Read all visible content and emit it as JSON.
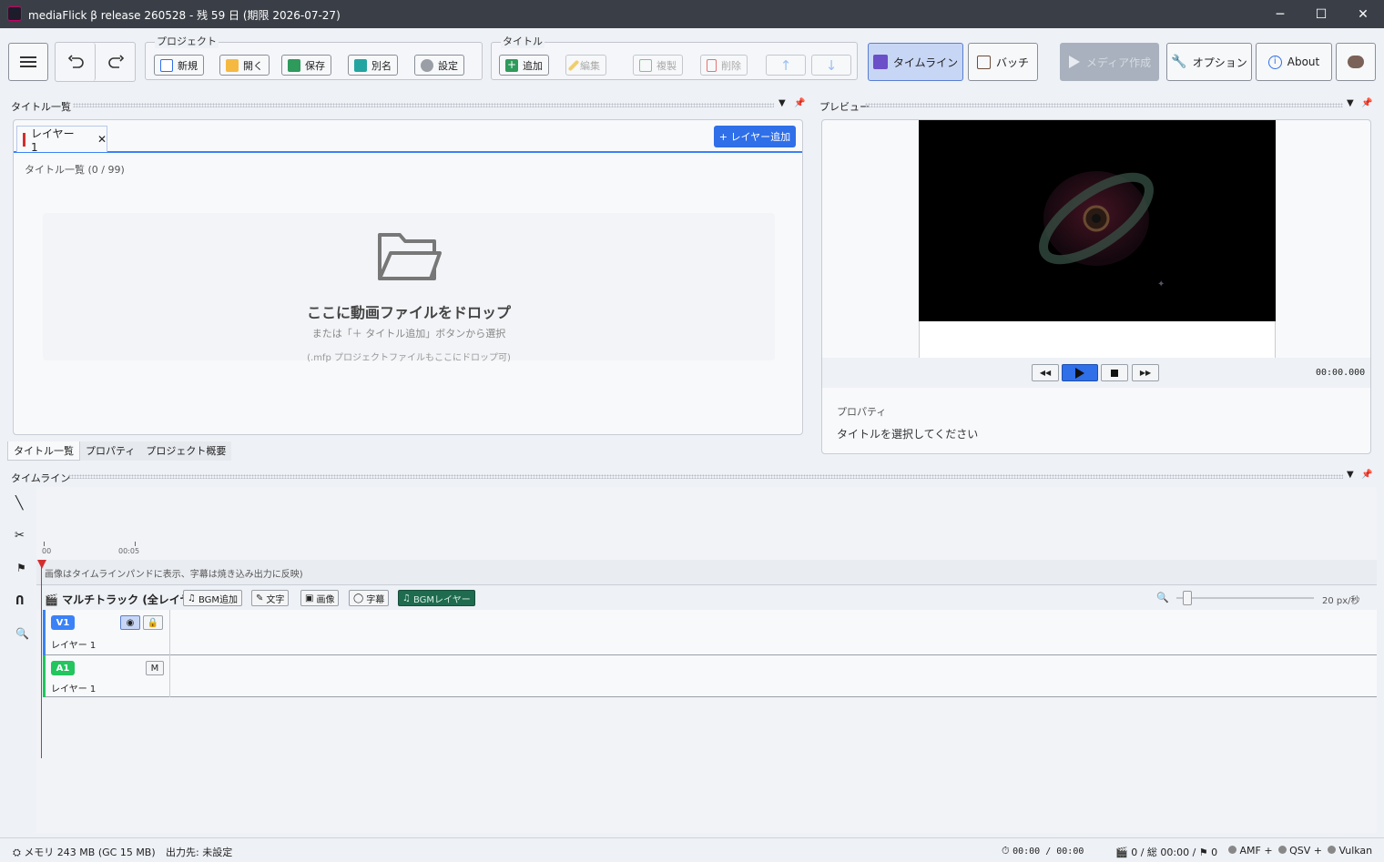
{
  "window": {
    "title": "mediaFlick β release 260528 - 残 59 日 (期限 2026-07-27)",
    "controls": {
      "minimize": "─",
      "maximize": "☐",
      "close": "✕"
    }
  },
  "toolbar": {
    "project_group": "プロジェクト",
    "project_buttons": {
      "new": "新規",
      "open": "開く",
      "save": "保存",
      "rename": "別名",
      "settings": "設定"
    },
    "title_group": "タイトル",
    "title_buttons": {
      "add": "追加",
      "edit": "編集",
      "copy": "複製",
      "delete": "削除"
    },
    "timeline": "タイムライン",
    "batch": "バッチ",
    "make_media": "メディア作成",
    "options": "オプション",
    "about": "About"
  },
  "title_panel": {
    "header": "タイトル一覧",
    "layer_tab": "レイヤー 1",
    "add_layer": "+ レイヤー追加",
    "count": "タイトル一覧 (0 / 99)",
    "drop_main": "ここに動画ファイルをドロップ",
    "drop_sub": "または「＋ タイトル追加」ボタンから選択",
    "drop_note": "(.mfp プロジェクトファイルもここにドロップ可)",
    "bottom_tabs": [
      "タイトル一覧",
      "プロパティ",
      "プロジェクト概要"
    ]
  },
  "preview": {
    "header": "プレビュー",
    "timecode": "00:00.000",
    "props_label": "プロパティ",
    "props_hint": "タイトルを選択してください"
  },
  "timeline": {
    "header": "タイムライン",
    "ruler": [
      "00",
      "00:05"
    ],
    "note": "画像はタイムラインパンドに表示、字幕は焼き込み出力に反映)",
    "multitrack": "マルチトラック (全レイヤー)",
    "buttons": {
      "bgm_add": "BGM追加",
      "text": "文字",
      "image": "画像",
      "subtitle": "字幕",
      "bgm_layer": "BGMレイヤー"
    },
    "zoom_label": "20 px/秒",
    "zoom_level": 0.05,
    "tracks": [
      {
        "badge": "V1",
        "name": "レイヤー 1",
        "color": "#3b82f6"
      },
      {
        "badge": "A1",
        "name": "レイヤー 1",
        "color": "#22c55e"
      }
    ],
    "mute": "M"
  },
  "status": {
    "memory": "メモリ 243 MB (GC 15 MB)",
    "output": "出力先: 未設定",
    "time": "00:00 / 00:00",
    "totals": "0 / 総 00:00 / ",
    "flags": "0",
    "encoders": [
      "AMF +",
      "QSV +",
      "Vulkan"
    ]
  },
  "colors": {
    "accent": "#2f6fe8",
    "timeline_active": "#c8d6f5",
    "bgm_layer": "#1f6b4f",
    "playhead": "#d32f2f"
  }
}
